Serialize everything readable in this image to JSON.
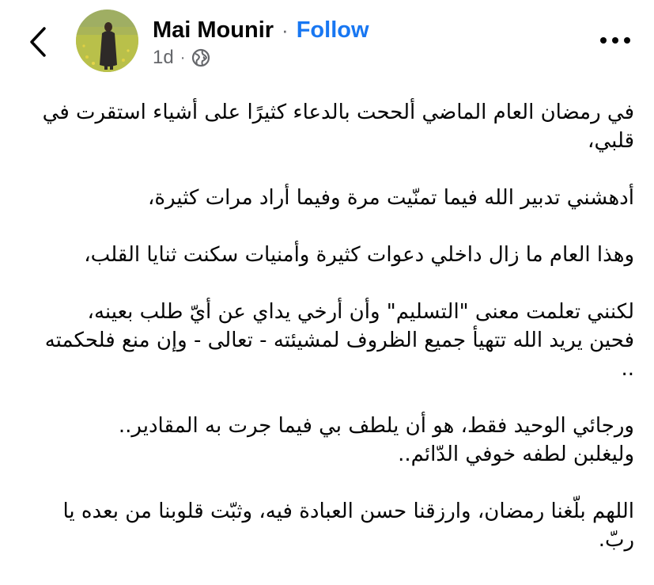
{
  "post": {
    "author": "Mai Mounir",
    "separator": "·",
    "follow_label": "Follow",
    "time": "1d",
    "meta_separator": "·",
    "audience_icon": "globe-icon",
    "back_icon": "chevron-left-icon",
    "more_icon": "more-horizontal-icon",
    "paragraphs": [
      [
        "في رمضان العام الماضي ألححت بالدعاء كثيرًا على أشياء استقرت في قلبي،"
      ],
      [
        "أدهشني تدبير الله فيما تمنّيت مرة وفيما أراد مرات كثيرة،"
      ],
      [
        "وهذا العام ما زال داخلي دعوات كثيرة وأمنيات سكنت ثنايا القلب،"
      ],
      [
        "لكنني تعلمت معنى \"التسليم\" وأن أرخي يداي عن أيّ طلب بعينه،",
        "فحين يريد الله تتهيأ جميع الظروف لمشيئته - تعالى - وإن منع فلحكمته .."
      ],
      [
        "ورجائي الوحيد فقط، هو أن يلطف بي فيما جرت به المقادير..",
        "وليغلبن لطفه خوفي الدّائم.."
      ],
      [
        "اللهم بلّغنا رمضان، وارزقنا حسن العبادة فيه، وثبّت قلوبنا من بعده يا ربّ."
      ]
    ]
  },
  "colors": {
    "link": "#1877f2",
    "text": "#050505",
    "secondary": "#65676b",
    "background": "#ffffff"
  }
}
